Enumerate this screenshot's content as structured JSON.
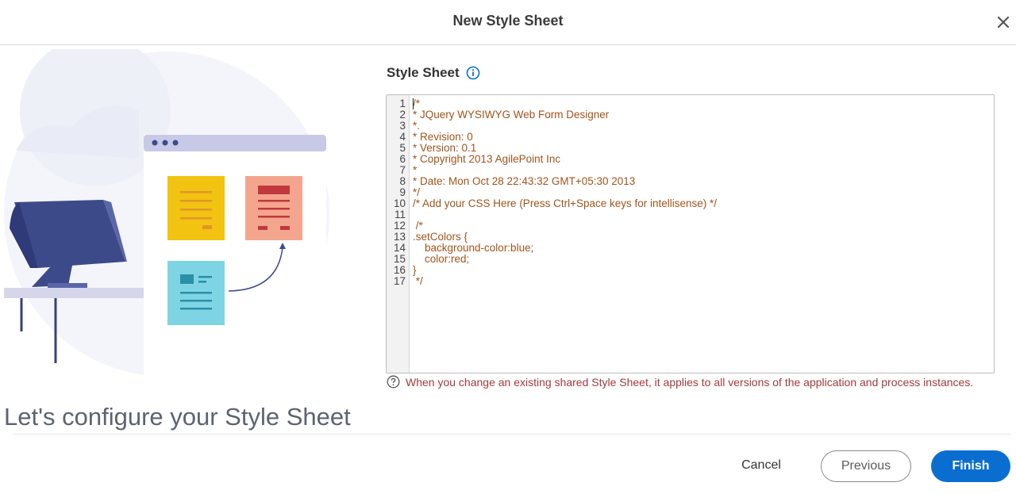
{
  "dialog": {
    "title": "New Style Sheet",
    "close_icon": "close-icon"
  },
  "section": {
    "label": "Style Sheet",
    "info_icon": "info-icon"
  },
  "editor": {
    "line_numbers": [
      "1",
      "2",
      "3",
      "4",
      "5",
      "6",
      "7",
      "8",
      "9",
      "10",
      "11",
      "12",
      "13",
      "14",
      "15",
      "16",
      "17"
    ],
    "lines": [
      "/*",
      "* JQuery WYSIWYG Web Form Designer",
      "*.",
      "* Revision: 0",
      "* Version: 0.1",
      "* Copyright 2013 AgilePoint Inc",
      "*",
      "* Date: Mon Oct 28 22:43:32 GMT+05:30 2013",
      "*/",
      "/* Add your CSS Here (Press Ctrl+Space keys for intellisense) */",
      "",
      " /*",
      ".setColors {",
      "    background-color:blue;",
      "    color:red;",
      "}",
      " */"
    ],
    "text_color": "#a0541b"
  },
  "hint": {
    "icon": "help-circle-icon",
    "text": "When you change an existing shared Style Sheet, it applies to all versions of the application and process instances."
  },
  "heading": "Let's configure your Style Sheet",
  "buttons": {
    "cancel": "Cancel",
    "previous": "Previous",
    "finish": "Finish"
  },
  "colors": {
    "accent": "#0a6ed1",
    "hint": "#a33a3a"
  }
}
